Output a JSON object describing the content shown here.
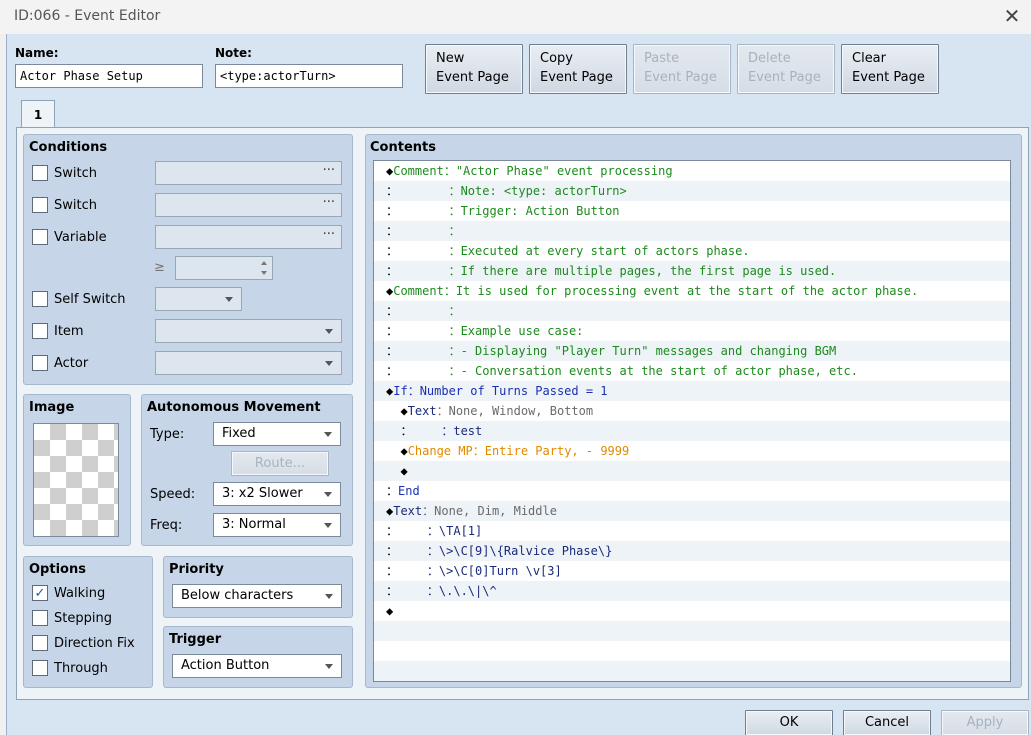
{
  "window": {
    "title": "ID:066 - Event Editor"
  },
  "header": {
    "name_label": "Name:",
    "name_value": "Actor Phase Setup",
    "note_label": "Note:",
    "note_value": "<type:actorTurn>",
    "buttons": {
      "new": [
        "New",
        "Event Page"
      ],
      "copy": [
        "Copy",
        "Event Page"
      ],
      "paste": [
        "Paste",
        "Event Page"
      ],
      "delete": [
        "Delete",
        "Event Page"
      ],
      "clear": [
        "Clear",
        "Event Page"
      ]
    }
  },
  "tabs": [
    {
      "label": "1"
    }
  ],
  "conditions": {
    "title": "Conditions",
    "switch1": "Switch",
    "switch2": "Switch",
    "variable": "Variable",
    "gte": "≥",
    "self_switch": "Self Switch",
    "item": "Item",
    "actor": "Actor",
    "ellipsis": "···"
  },
  "image": {
    "title": "Image"
  },
  "movement": {
    "title": "Autonomous Movement",
    "type_label": "Type:",
    "type_value": "Fixed",
    "route_button": "Route...",
    "speed_label": "Speed:",
    "speed_value": "3: x2 Slower",
    "freq_label": "Freq:",
    "freq_value": "3: Normal"
  },
  "options": {
    "title": "Options",
    "walking": "Walking",
    "stepping": "Stepping",
    "direction_fix": "Direction Fix",
    "through": "Through",
    "walking_checked": true,
    "check_mark": "✓"
  },
  "priority": {
    "title": "Priority",
    "value": "Below characters"
  },
  "trigger": {
    "title": "Trigger",
    "value": "Action Button"
  },
  "contents": {
    "title": "Contents",
    "lines": [
      [
        [
          "◆",
          "c-black"
        ],
        [
          "Comment",
          "c-green"
        ],
        [
          "：\"Actor Phase\" event processing",
          "c-green"
        ]
      ],
      [
        [
          "：       ",
          "c-black"
        ],
        [
          "：Note: <type: actorTurn>",
          "c-green"
        ]
      ],
      [
        [
          "：       ",
          "c-black"
        ],
        [
          "：Trigger: Action Button",
          "c-green"
        ]
      ],
      [
        [
          "：       ",
          "c-black"
        ],
        [
          "：",
          "c-green"
        ]
      ],
      [
        [
          "：       ",
          "c-black"
        ],
        [
          "：Executed at every start of actors phase.",
          "c-green"
        ]
      ],
      [
        [
          "：       ",
          "c-black"
        ],
        [
          "：If there are multiple pages, the first page is used.",
          "c-green"
        ]
      ],
      [
        [
          "◆",
          "c-black"
        ],
        [
          "Comment",
          "c-green"
        ],
        [
          "：It is used for processing event at the start of the actor phase.",
          "c-green"
        ]
      ],
      [
        [
          "：       ",
          "c-black"
        ],
        [
          "：",
          "c-green"
        ]
      ],
      [
        [
          "：       ",
          "c-black"
        ],
        [
          "：Example use case:",
          "c-green"
        ]
      ],
      [
        [
          "：       ",
          "c-black"
        ],
        [
          "：- Displaying \"Player Turn\" messages and changing BGM",
          "c-green"
        ]
      ],
      [
        [
          "：       ",
          "c-black"
        ],
        [
          "：- Conversation events at the start of actor phase, etc.",
          "c-green"
        ]
      ],
      [
        [
          "◆",
          "c-black"
        ],
        [
          "If",
          "c-blue"
        ],
        [
          "：Number of Turns Passed = 1",
          "c-blue"
        ]
      ],
      [
        [
          "  ◆",
          "c-black"
        ],
        [
          "Text",
          "c-navy"
        ],
        [
          "：None, Window, Bottom",
          "c-gray"
        ]
      ],
      [
        [
          "  ：    ",
          "c-black"
        ],
        [
          "：test",
          "c-navy"
        ]
      ],
      [
        [
          "  ◆",
          "c-black"
        ],
        [
          "Change MP",
          "c-orange"
        ],
        [
          "：Entire Party, - 9999",
          "c-orange"
        ]
      ],
      [
        [
          "  ◆",
          "c-black"
        ]
      ],
      [
        [
          "：",
          "c-black"
        ],
        [
          "End",
          "c-blue"
        ]
      ],
      [
        [
          "◆",
          "c-black"
        ],
        [
          "Text",
          "c-navy"
        ],
        [
          "：None, Dim, Middle",
          "c-gray"
        ]
      ],
      [
        [
          "：    ",
          "c-black"
        ],
        [
          "：\\TA[1]",
          "c-navy"
        ]
      ],
      [
        [
          "：    ",
          "c-black"
        ],
        [
          "：\\>\\C[9]\\{Ralvice Phase\\}",
          "c-navy"
        ]
      ],
      [
        [
          "：    ",
          "c-black"
        ],
        [
          "：\\>\\C[0]Turn \\v[3]",
          "c-navy"
        ]
      ],
      [
        [
          "：    ",
          "c-black"
        ],
        [
          "：\\.\\.\\|\\^",
          "c-navy"
        ]
      ],
      [
        [
          "◆",
          "c-black"
        ]
      ],
      [
        [
          "",
          "c-black"
        ]
      ],
      [
        [
          "",
          "c-black"
        ]
      ],
      [
        [
          "",
          "c-black"
        ]
      ]
    ]
  },
  "footer": {
    "ok": "OK",
    "cancel": "Cancel",
    "apply": "Apply"
  },
  "colors": {
    "panel_bg": "#c6d6e8",
    "client_bg": "#d7e4f2",
    "comment_green": "#1d8a1d",
    "if_blue": "#1b2fb3",
    "mp_orange": "#e08a00"
  }
}
